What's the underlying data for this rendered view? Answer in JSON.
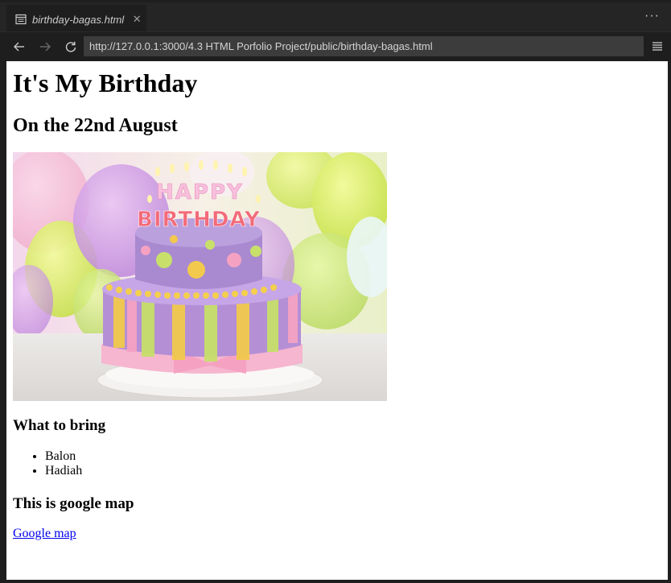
{
  "tab": {
    "title": "birthday-bagas.html",
    "icon": "preview-icon",
    "close_glyph": "✕"
  },
  "toolbar": {
    "more_glyph": "···",
    "back_icon": "arrow-left-icon",
    "forward_icon": "arrow-right-icon",
    "reload_icon": "reload-icon",
    "menu_icon": "hamburger-menu-icon"
  },
  "address": {
    "url": "http://127.0.0.1:3000/4.3 HTML Porfolio Project/public/birthday-bagas.html"
  },
  "page": {
    "heading": "It's My Birthday",
    "subheading": "On the 22nd August",
    "image": {
      "candle_letters_top": "HAPPY",
      "candle_letters_bottom": "BIRTHDAY"
    },
    "bring_heading": "What to bring",
    "bring_items": [
      "Balon",
      "Hadiah"
    ],
    "map_heading": "This is google map",
    "map_link": "Google map"
  },
  "colors": {
    "chrome_bg": "#1e1e1e",
    "tabbar_bg": "#252526",
    "url_bg": "#3c3c3c",
    "link": "#0000ee"
  }
}
